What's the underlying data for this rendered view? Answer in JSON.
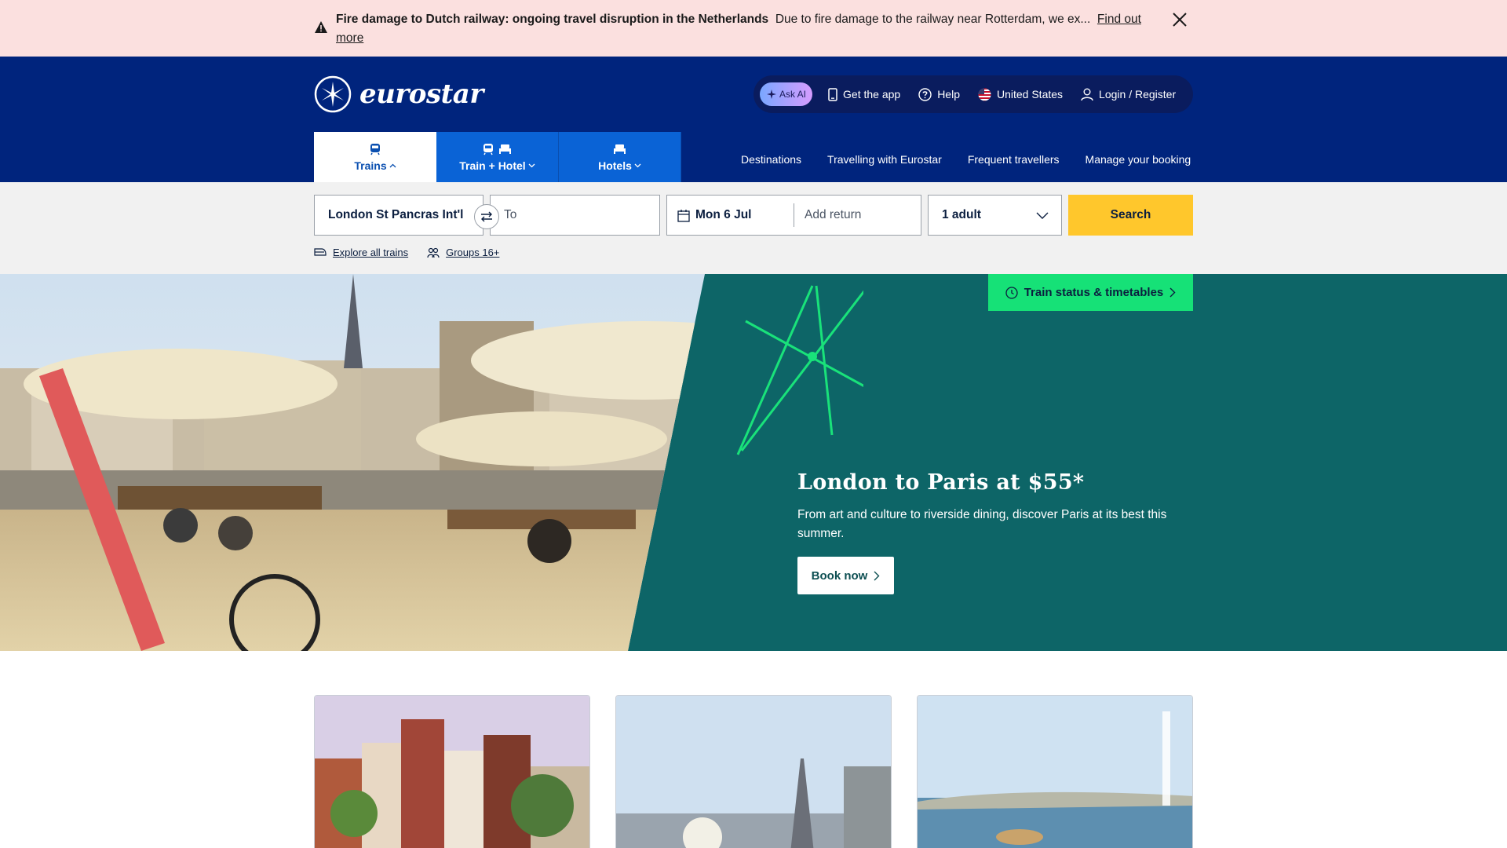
{
  "alert": {
    "title": "Fire damage to Dutch railway: ongoing travel disruption in the Netherlands",
    "body": "Due to fire damage to the railway near Rotterdam, we ex...",
    "link": "Find out more",
    "icon": "warning-icon",
    "close_icon": "close-icon"
  },
  "header": {
    "brand": "eurostar",
    "ask_ai": "Ask AI",
    "utility": {
      "get_app": "Get the app",
      "help": "Help",
      "country": "United States",
      "login": "Login / Register"
    },
    "tabs": [
      {
        "label": "Trains",
        "active": true
      },
      {
        "label": "Train + Hotel",
        "active": false
      },
      {
        "label": "Hotels",
        "active": false
      }
    ],
    "nav": [
      "Destinations",
      "Travelling with Eurostar",
      "Frequent travellers",
      "Manage your booking"
    ]
  },
  "search": {
    "from_value": "London St Pancras Int'l",
    "to_placeholder": "To",
    "outbound_date": "Mon 6 Jul",
    "return_placeholder": "Add return",
    "passengers": "1 adult",
    "search_label": "Search",
    "explore_link": "Explore all trains",
    "groups_link": "Groups 16+"
  },
  "hero": {
    "status_button": "Train status & timetables",
    "title": "London to Paris at $55*",
    "description": "From art and culture to riverside dining, discover Paris at its best this summer.",
    "cta": "Book now"
  },
  "colors": {
    "brand_navy": "#00247d",
    "tab_blue": "#0a63d6",
    "search_yellow": "#ffc72c",
    "hero_teal": "#0d6567",
    "status_green": "#16e177",
    "alert_pink": "#fbe0df"
  }
}
